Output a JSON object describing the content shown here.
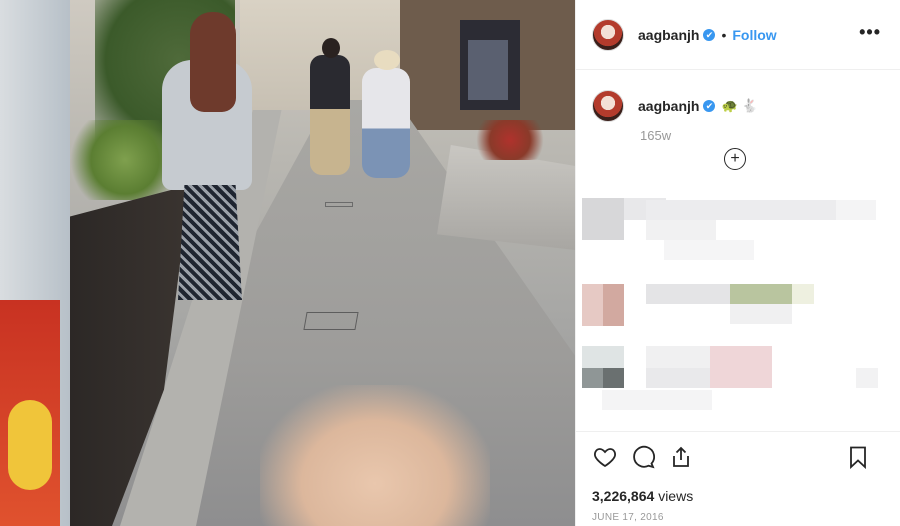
{
  "post": {
    "username": "aagbanjh",
    "verified_badge": "✔",
    "separator": "•",
    "follow_label": "Follow",
    "more_label": "•••",
    "caption_emoji_1": "🐢",
    "caption_emoji_2": "🐇",
    "time_ago": "165w",
    "load_more_label": "+",
    "view_count": "3,226,864",
    "views_label": "views",
    "date": "JUNE 17, 2016",
    "icons": {
      "like": "heart-icon",
      "comment": "comment-bubble-icon",
      "share": "share-icon",
      "save": "bookmark-icon"
    }
  },
  "colors": {
    "accent": "#3897f0",
    "text": "#262626",
    "muted": "#999999",
    "border": "#efefef"
  }
}
